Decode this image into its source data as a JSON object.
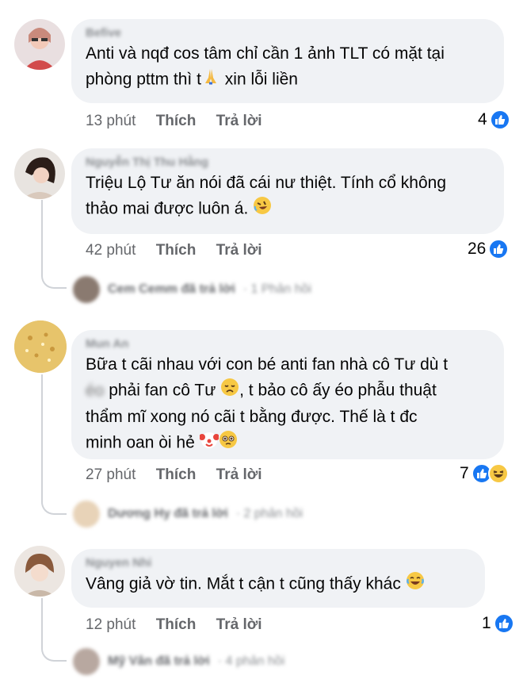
{
  "comments": [
    {
      "name": "Befive",
      "text": "Anti và nqđ cos tâm chỉ cần 1 ảnh TLT có mặt tại\nphòng pttm thì t",
      "text_after_emoji": " xin lỗi liền",
      "time": "13 phút",
      "like_label": "Thích",
      "reply_label": "Trả lời",
      "reaction_count": "4"
    },
    {
      "name": "Nguyễn Thị Thu Hằng",
      "text": "Triệu Lộ Tư ăn nói đã cái nư thiệt. Tính cổ không\nthảo mai được luôn á.",
      "time": "42 phút",
      "like_label": "Thích",
      "reply_label": "Trả lời",
      "reaction_count": "26",
      "reply_summary": {
        "name": "Cem Cemm đã trả lời",
        "count": "· 1 Phản hồi"
      }
    },
    {
      "name": "Mun An",
      "line1": "Bữa t cãi nhau với con bé anti fan nhà cô Tư dù t",
      "line2_prefix": "éo",
      "line2": " phải fan cô Tư",
      "line2_after": ", t bảo cô ấy éo phẫu thuật",
      "line3": "thẩm mĩ xong nó cãi t bằng được. Thế là t đc",
      "line4": "minh oan òi hẻ",
      "time": "27 phút",
      "like_label": "Thích",
      "reply_label": "Trả lời",
      "reaction_count": "7",
      "reply_summary": {
        "name": "Dương Hy đã trả lời",
        "count": "· 2 phản hồi"
      }
    },
    {
      "name": "Nguyen Nhi",
      "text": "Vâng giả vờ tin. Mắt t cận t cũng thấy khác",
      "time": "12 phút",
      "like_label": "Thích",
      "reply_label": "Trả lời",
      "reaction_count": "1",
      "reply_summary": {
        "name": "Mỹ Vân đã trả lời",
        "count": "· 4 phản hồi"
      }
    }
  ],
  "icons": {
    "like": "like-reaction-icon",
    "haha": "haha-reaction-icon",
    "pray": "folded-hands-emoji",
    "rofl": "rolling-laughing-emoji",
    "sad": "disappointed-face-emoji",
    "clown": "clown-face-emoji",
    "pleading": "pleading-face-emoji",
    "joy": "tears-of-joy-emoji"
  },
  "colors": {
    "bubble": "#f0f2f5",
    "like_blue": "#1877f2",
    "meta_gray": "#65676b"
  }
}
